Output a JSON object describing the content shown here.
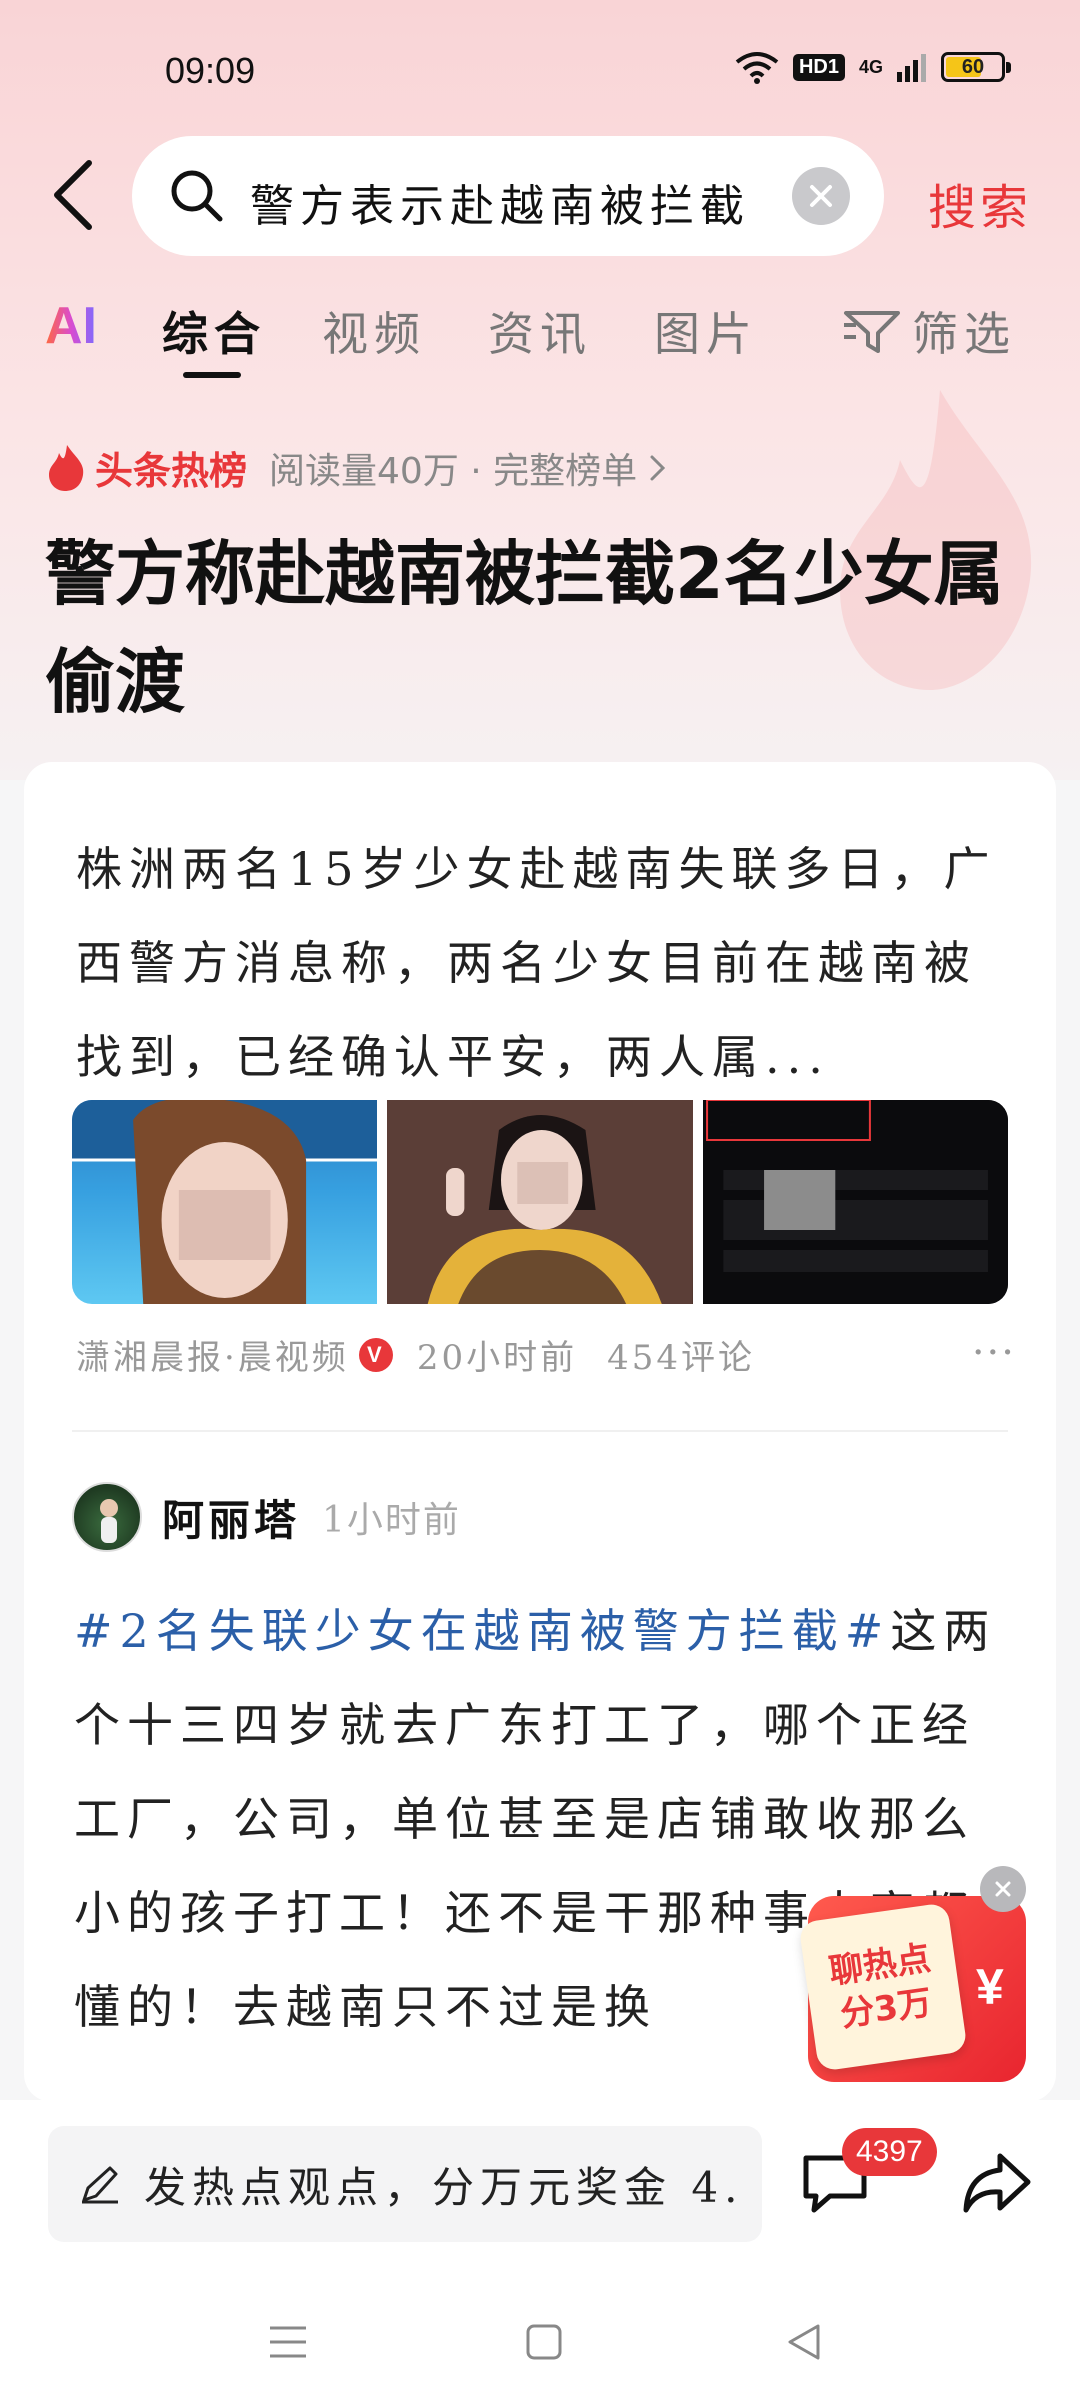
{
  "status_bar": {
    "time": "09:09",
    "hd": "HD1",
    "network": "4G",
    "battery": "60"
  },
  "search": {
    "query": "警方表示赴越南被拦截",
    "submit_label": "搜索"
  },
  "tabs": {
    "ai": "AI",
    "items": [
      "综合",
      "视频",
      "资讯",
      "图片"
    ],
    "active": "综合",
    "filter": "筛选"
  },
  "hot": {
    "label": "头条热榜",
    "meta": "阅读量40万 · 完整榜单",
    "headline": "警方称赴越南被拦截2名少女属偷渡"
  },
  "article": {
    "summary": "株洲两名15岁少女赴越南失联多日，广西警方消息称，两名少女目前在越南被找到，已经确认平安，两人属...",
    "source": "潇湘晨报·晨视频",
    "verified": "V",
    "time": "20小时前",
    "comments": "454评论",
    "more": "···"
  },
  "post": {
    "author": "阿丽塔",
    "time": "1小时前",
    "hashtag": "#2名失联少女在越南被警方拦截#",
    "body": "这两个十三四岁就去广东打工了，哪个正经工厂，公司，单位甚至是店铺敢收那么小的孩子打工！还不是干那种事大家都懂的！去越南只不过是换"
  },
  "promo": {
    "line1": "聊热点",
    "line2": "分3万",
    "symbol": "¥"
  },
  "bottom": {
    "comment_placeholder": "发热点观点，分万元奖金 4.",
    "comment_count": "4397"
  },
  "colors": {
    "accent": "#e8373a",
    "hashtag": "#2b5fa8"
  }
}
